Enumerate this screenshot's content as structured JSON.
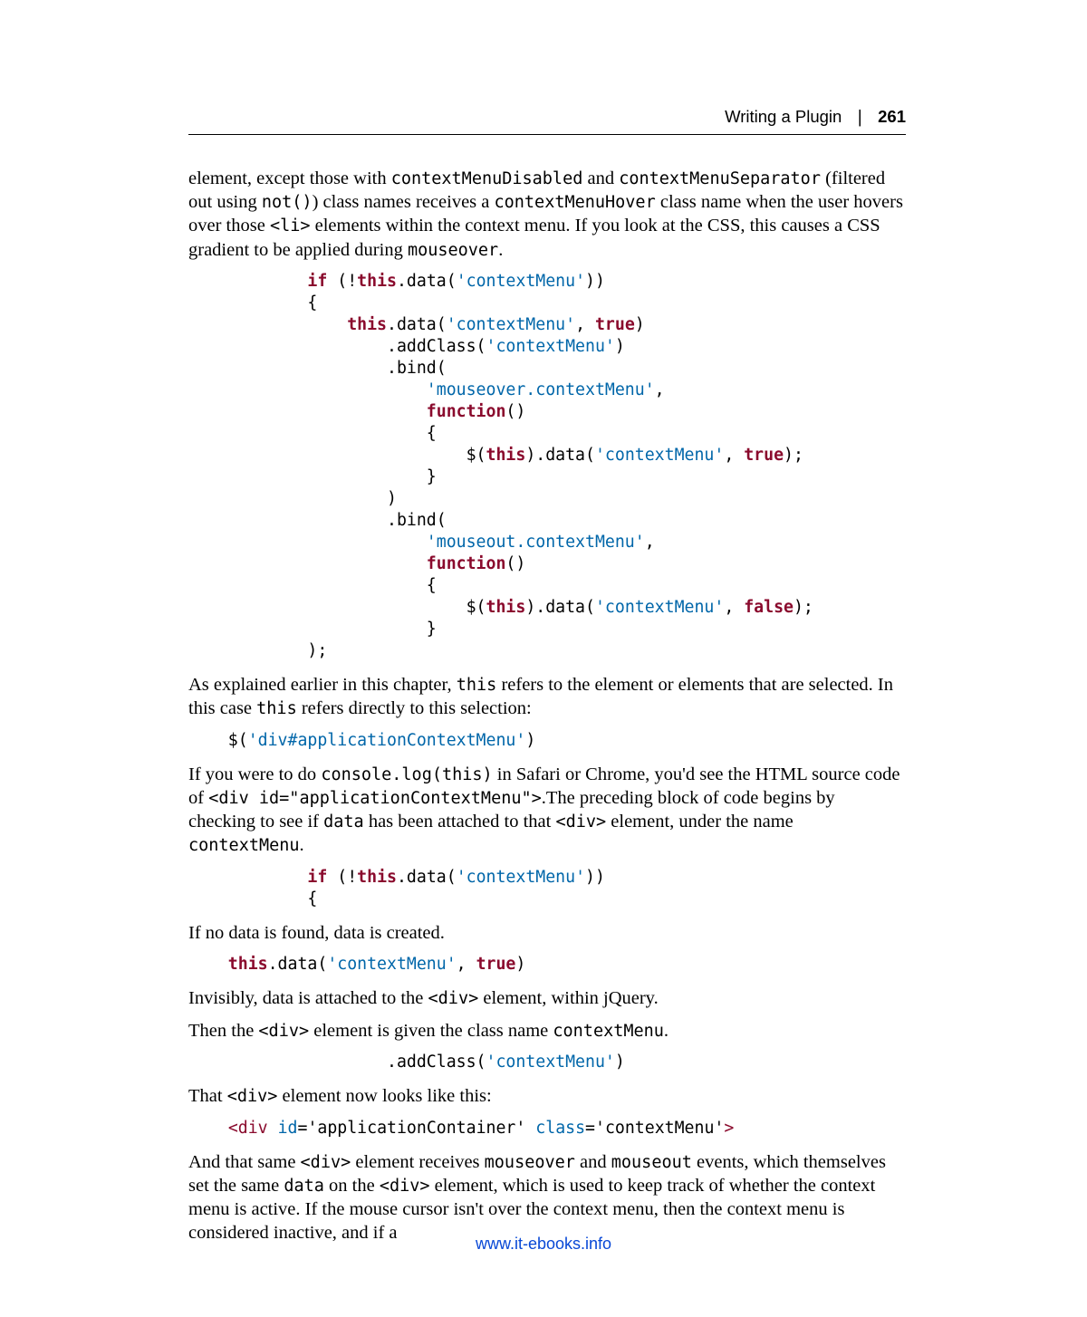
{
  "header": {
    "section": "Writing a Plugin",
    "separator": "❘",
    "pageNumber": "261"
  },
  "para1_a": "element, except those with ",
  "para1_code1": "contextMenuDisabled",
  "para1_b": " and ",
  "para1_code2": "contextMenuSeparator",
  "para1_c": " (filtered out using ",
  "para1_code3": "not()",
  "para1_d": ") class names receives a ",
  "para1_code4": "contextMenuHover",
  "para1_e": " class name when the user hovers over those ",
  "para1_code5": "<li>",
  "para1_f": " elements within the context menu. If you look at the CSS, this causes a CSS gradient to be applied during ",
  "para1_code6": "mouseover",
  "para1_g": ".",
  "code1": {
    "l01_a": "            if",
    "l01_b": " (!",
    "l01_c": "this",
    "l01_d": ".data(",
    "l01_e": "'contextMenu'",
    "l01_f": "))",
    "l02": "            {",
    "l03_a": "                this",
    "l03_b": ".data(",
    "l03_c": "'contextMenu'",
    "l03_d": ", ",
    "l03_e": "true",
    "l03_f": ")",
    "l04_a": "                    .addClass(",
    "l04_b": "'contextMenu'",
    "l04_c": ")",
    "l05": "                    .bind(",
    "l06_a": "                        ",
    "l06_b": "'mouseover.contextMenu'",
    "l06_c": ",",
    "l07_a": "                        ",
    "l07_b": "function",
    "l07_c": "()",
    "l08": "                        {",
    "l09_a": "                            $(",
    "l09_b": "this",
    "l09_c": ").data(",
    "l09_d": "'contextMenu'",
    "l09_e": ", ",
    "l09_f": "true",
    "l09_g": ");",
    "l10": "                        }",
    "l11": "                    )",
    "l12": "                    .bind(",
    "l13_a": "                        ",
    "l13_b": "'mouseout.contextMenu'",
    "l13_c": ",",
    "l14_a": "                        ",
    "l14_b": "function",
    "l14_c": "()",
    "l15": "                        {",
    "l16_a": "                            $(",
    "l16_b": "this",
    "l16_c": ").data(",
    "l16_d": "'contextMenu'",
    "l16_e": ", ",
    "l16_f": "false",
    "l16_g": ");",
    "l17": "                        }",
    "l18": "            );"
  },
  "para2_a": "As explained earlier in this chapter, ",
  "para2_code1": "this",
  "para2_b": " refers to the element or elements that are selected. In this case ",
  "para2_code2": "this",
  "para2_c": " refers directly to this selection:",
  "code2_a": "    $(",
  "code2_b": "'div#applicationContextMenu'",
  "code2_c": ")",
  "para3_a": "If you were to do ",
  "para3_code1": "console.log(this)",
  "para3_b": " in Safari or Chrome, you'd see the HTML source code of ",
  "para3_code2": "<div id=\"applicationContextMenu\">",
  "para3_c": ".The preceding block of code begins by checking to see if ",
  "para3_code3": "data",
  "para3_d": " has been attached to that ",
  "para3_code4": "<div>",
  "para3_e": " element, under the name ",
  "para3_code5": "contextMenu",
  "para3_f": ".",
  "code3": {
    "l1_a": "            if",
    "l1_b": " (!",
    "l1_c": "this",
    "l1_d": ".data(",
    "l1_e": "'contextMenu'",
    "l1_f": "))",
    "l2": "            {"
  },
  "para4": "If no data is found, data is created.",
  "code4_a": "    this",
  "code4_b": ".data(",
  "code4_c": "'contextMenu'",
  "code4_d": ", ",
  "code4_e": "true",
  "code4_f": ")",
  "para5_a": "Invisibly, data is attached to the ",
  "para5_code1": "<div>",
  "para5_b": " element, within jQuery.",
  "para6_a": "Then the ",
  "para6_code1": "<div>",
  "para6_b": " element is given the class name ",
  "para6_code2": "contextMenu",
  "para6_c": ".",
  "code5_a": "                    .addClass(",
  "code5_b": "'contextMenu'",
  "code5_c": ")",
  "para7_a": "That ",
  "para7_code1": "<div>",
  "para7_b": " element now looks like this:",
  "code6": {
    "a": "    ",
    "lt1": "<",
    "tag": "div",
    "sp1": " ",
    "attr1": "id",
    "eq1": "=",
    "val1": "'applicationContainer'",
    "sp2": " ",
    "attr2": "class",
    "eq2": "=",
    "val2": "'contextMenu'",
    "gt1": ">"
  },
  "para8_a": "And that same ",
  "para8_code1": "<div>",
  "para8_b": " element receives ",
  "para8_code2": "mouseover",
  "para8_c": " and ",
  "para8_code3": "mouseout",
  "para8_d": " events, which themselves set the same ",
  "para8_code4": "data",
  "para8_e": " on the ",
  "para8_code5": "<div>",
  "para8_f": " element, which is used to keep track of whether the context menu is active. If the mouse cursor isn't over the context menu, then the context menu is considered inactive, and if a",
  "footer": {
    "url": "www.it-ebooks.info",
    "href": "http://www.it-ebooks.info"
  }
}
